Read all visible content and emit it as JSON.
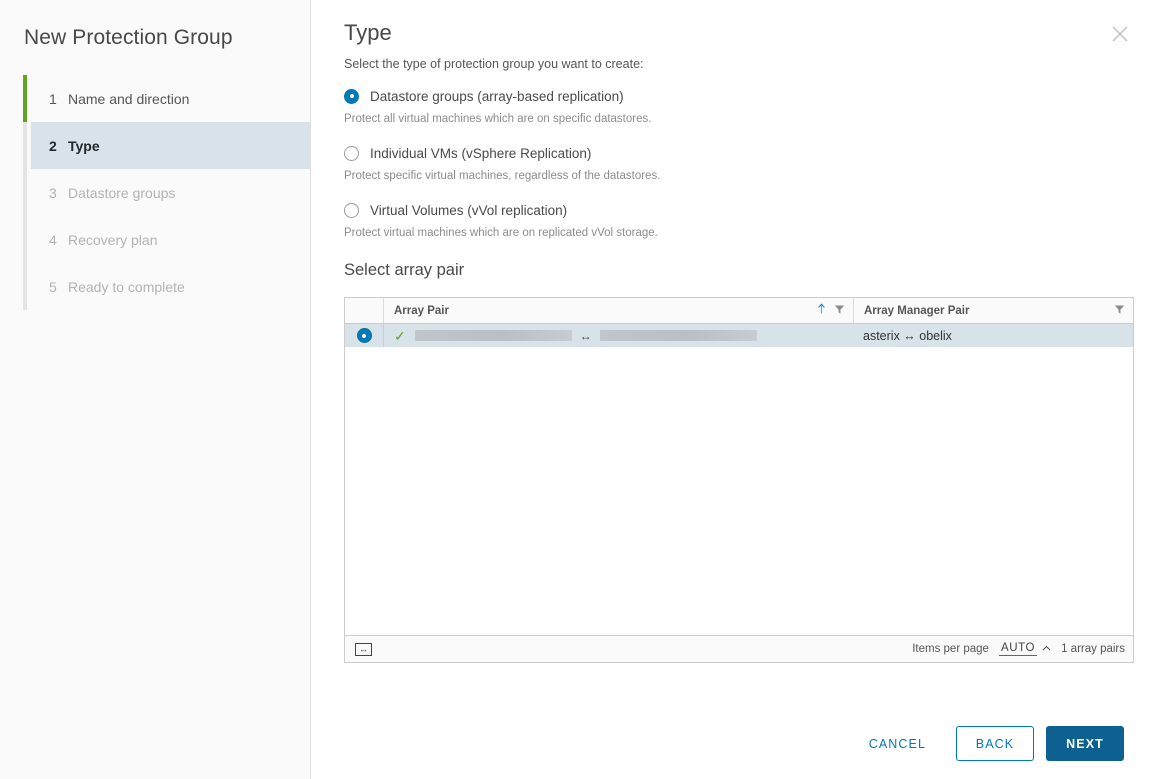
{
  "wizard": {
    "title": "New Protection Group",
    "close_icon": "close-icon",
    "steps": [
      {
        "num": "1",
        "label": "Name and direction",
        "state": "done"
      },
      {
        "num": "2",
        "label": "Type",
        "state": "active"
      },
      {
        "num": "3",
        "label": "Datastore groups",
        "state": "future"
      },
      {
        "num": "4",
        "label": "Recovery plan",
        "state": "future"
      },
      {
        "num": "5",
        "label": "Ready to complete",
        "state": "future"
      }
    ],
    "progress_color": "#62a420",
    "accent_color": "#0079b8",
    "active_step_bg": "#d8e3e9"
  },
  "page": {
    "title": "Type",
    "subtitle": "Select the type of protection group you want to create:",
    "options": [
      {
        "label": "Datastore groups (array-based replication)",
        "description": "Protect all virtual machines which are on specific datastores.",
        "selected": true
      },
      {
        "label": "Individual VMs (vSphere Replication)",
        "description": "Protect specific virtual machines, regardless of the datastores.",
        "selected": false
      },
      {
        "label": "Virtual Volumes (vVol replication)",
        "description": "Protect virtual machines which are on replicated vVol storage.",
        "selected": false
      }
    ]
  },
  "array_pair": {
    "heading": "Select array pair",
    "columns": {
      "select": "",
      "array_pair": "Array Pair",
      "array_manager_pair": "Array Manager Pair"
    },
    "header_icons": {
      "sort_ascending": "sort-ascending-icon",
      "filter": "filter-icon"
    },
    "rows": [
      {
        "selected": true,
        "status_icon": "check-icon",
        "array_pair_left": "",
        "array_pair_separator": "↔",
        "array_pair_right": "",
        "array_manager_pair": "asterix ↔ obelix"
      }
    ],
    "footer": {
      "fit_columns_icon": "fit-columns-icon",
      "items_per_page_label": "Items per page",
      "items_per_page_value": "AUTO",
      "items_per_page_caret": "⌃",
      "total_label": "1 array pairs"
    }
  },
  "actions": {
    "cancel": "CANCEL",
    "back": "BACK",
    "next": "NEXT"
  }
}
